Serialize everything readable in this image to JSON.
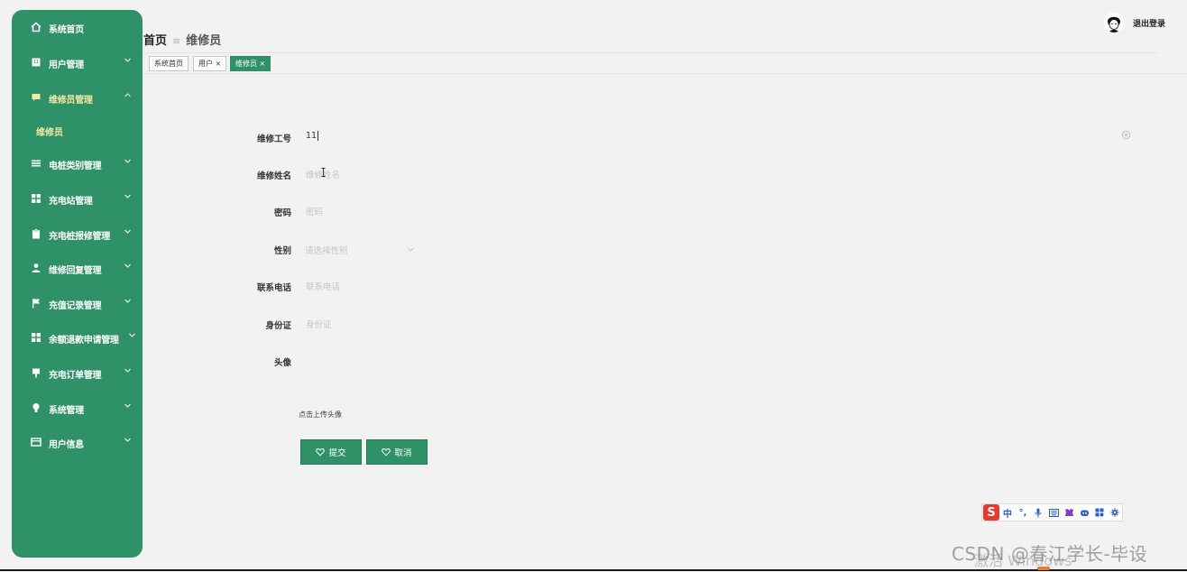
{
  "sidebar": {
    "items": [
      {
        "label": "系统首页",
        "icon": "home-icon"
      },
      {
        "label": "用户管理",
        "icon": "building-icon"
      },
      {
        "label": "维修员管理",
        "icon": "chat-icon"
      },
      {
        "label": "维修员"
      },
      {
        "label": "电桩类别管理",
        "icon": "menu-icon"
      },
      {
        "label": "充电站管理",
        "icon": "grid-icon"
      },
      {
        "label": "充电桩报修管理",
        "icon": "clipboard-icon"
      },
      {
        "label": "维修回复管理",
        "icon": "person-icon"
      },
      {
        "label": "充值记录管理",
        "icon": "flag-icon"
      },
      {
        "label": "余额退款申请管理",
        "icon": "grid-icon"
      },
      {
        "label": "充电订单管理",
        "icon": "pin-icon"
      },
      {
        "label": "系统管理",
        "icon": "bulb-icon"
      },
      {
        "label": "用户信息",
        "icon": "card-icon"
      }
    ]
  },
  "header": {
    "crumb_home": "首页",
    "crumb_sep": "≡",
    "crumb_current": "维修员",
    "logout": "退出登录"
  },
  "tabs": [
    {
      "label": "系统首页"
    },
    {
      "label": "用户 ×"
    },
    {
      "label": "维修员 ×"
    }
  ],
  "form": {
    "fields": [
      {
        "label": "维修工号",
        "value": "11",
        "placeholder": ""
      },
      {
        "label": "维修姓名",
        "value": "",
        "placeholder": "维修姓名"
      },
      {
        "label": "密码",
        "value": "",
        "placeholder": "密码"
      },
      {
        "label": "性别",
        "value": "",
        "placeholder": "请选择性别"
      },
      {
        "label": "联系电话",
        "value": "",
        "placeholder": "联系电话"
      },
      {
        "label": "身份证",
        "value": "",
        "placeholder": "身份证"
      },
      {
        "label": "头像",
        "value": "",
        "placeholder": ""
      }
    ],
    "upload_tip": "点击上传头像",
    "submit_label": "提交",
    "cancel_label": "取消"
  },
  "ime": {
    "logo": "S",
    "mode": "中",
    "punct": "°,"
  },
  "watermark": "CSDN @春江学长-毕设",
  "windows_text": "激活 Windows",
  "colors": {
    "primary": "#2e9168",
    "sidebar_active": "#f5e9a6",
    "background": "#f2f2f2"
  }
}
